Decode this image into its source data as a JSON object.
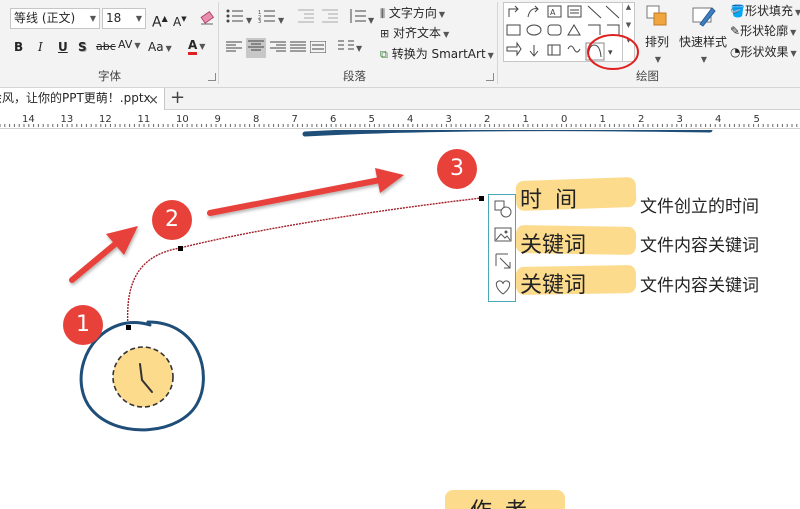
{
  "ribbon": {
    "font": {
      "name": "等线 (正文)",
      "size": "18",
      "group_label": "字体",
      "grow": "A",
      "shrink": "A",
      "bold": "B",
      "italic": "I",
      "underline": "U",
      "shadow": "S",
      "strike": "abc",
      "spacing": "AV",
      "case": "Aa",
      "color": "A"
    },
    "paragraph": {
      "group_label": "段落",
      "text_direction": "文字方向",
      "align_text": "对齐文本",
      "convert_smartart": "转换为 SmartArt"
    },
    "drawing": {
      "group_label": "绘图",
      "arrange": "排列",
      "quick_styles": "快速样式",
      "shape_fill": "形状填充",
      "shape_outline": "形状轮廓",
      "shape_effects": "形状效果"
    }
  },
  "tabs": {
    "document_tab": "绘风，让你的PPT更萌！.pptx",
    "close_symbol": "×",
    "add_symbol": "+"
  },
  "ruler": {
    "labels": [
      "14",
      "13",
      "12",
      "11",
      "10",
      "9",
      "8",
      "7",
      "6",
      "5",
      "4",
      "3",
      "2",
      "1",
      "0",
      "1",
      "2",
      "3",
      "4",
      "5"
    ]
  },
  "slide": {
    "markers": [
      "1",
      "2",
      "3"
    ],
    "rows": [
      {
        "title": "时  间",
        "desc": "文件创立的时间"
      },
      {
        "title": "关键词",
        "desc": "文件内容关键词"
      },
      {
        "title": "关键词",
        "desc": "文件内容关键词"
      }
    ],
    "bottom_partial": "作 者"
  },
  "colors": {
    "marker": "#e8413a",
    "highlight": "#fcdb8d",
    "curve": "#a3202b",
    "clock_ring": "#1f4e79",
    "annotation": "#e02020"
  }
}
